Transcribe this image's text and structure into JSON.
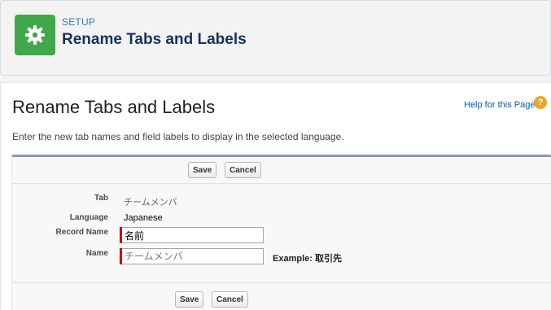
{
  "header": {
    "eyebrow": "SETUP",
    "title": "Rename Tabs and Labels",
    "icon": "gear-icon",
    "icon_bg": "#3fa84a"
  },
  "main": {
    "title": "Rename Tabs and Labels",
    "help_link": "Help for this Page",
    "help_icon": "?",
    "intro": "Enter the new tab names and field labels to display in the selected language."
  },
  "form": {
    "save_label": "Save",
    "cancel_label": "Cancel",
    "fields": {
      "tab": {
        "label": "Tab",
        "value": "チームメンバ"
      },
      "language": {
        "label": "Language",
        "value": "Japanese"
      },
      "record_name": {
        "label": "Record Name",
        "value": "名前"
      },
      "name": {
        "label": "Name",
        "value": "",
        "placeholder": "チームメンバ"
      }
    },
    "example": "Example: 取引先"
  },
  "colors": {
    "accent": "#3fa84a",
    "link": "#015ba7",
    "required": "#cc0000",
    "help_icon": "#e9a526"
  }
}
